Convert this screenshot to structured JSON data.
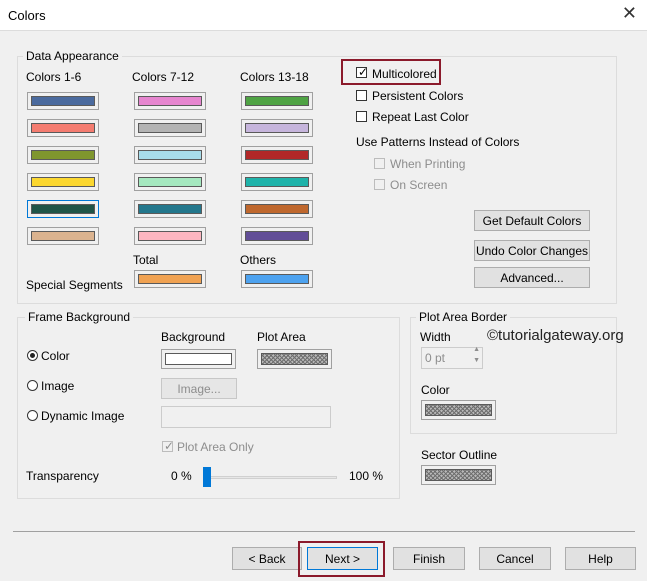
{
  "window": {
    "title": "Colors"
  },
  "data_appearance": {
    "label": "Data Appearance",
    "col1_label": "Colors 1-6",
    "col2_label": "Colors 7-12",
    "col3_label": "Colors 13-18",
    "colors_1_6": [
      "#4a6a9e",
      "#f47c70",
      "#7f962e",
      "#fbd730",
      "#1f5448",
      "#dbb38f"
    ],
    "colors_7_12": [
      "#e685cf",
      "#b3b3b3",
      "#a7dcea",
      "#a5e8bf",
      "#23778c",
      "#fdb6c0"
    ],
    "colors_13_18": [
      "#4fa344",
      "#c6b5dc",
      "#b22828",
      "#1fb3aa",
      "#bf682e",
      "#624e97"
    ],
    "special_label": "Special Segments",
    "total_label": "Total",
    "others_label": "Others",
    "total_color": "#f0a252",
    "others_color": "#4da2ef",
    "multicolored": "Multicolored",
    "persistent": "Persistent Colors",
    "repeat_last": "Repeat Last Color",
    "patterns_label": "Use Patterns Instead of Colors",
    "when_printing": "When Printing",
    "on_screen": "On Screen",
    "get_default": "Get Default Colors",
    "undo_changes": "Undo Color Changes",
    "advanced": "Advanced..."
  },
  "frame_background": {
    "label": "Frame Background",
    "background_label": "Background",
    "plot_area_label": "Plot Area",
    "opt_color": "Color",
    "opt_image": "Image",
    "opt_dynamic": "Dynamic Image",
    "image_button": "Image...",
    "plot_area_only": "Plot Area Only",
    "transparency_label": "Transparency",
    "min_label": "0 %",
    "max_label": "100 %",
    "transparency_value": 0
  },
  "plot_area_border": {
    "label": "Plot Area Border",
    "width_label": "Width",
    "width_value": "0 pt",
    "color_label": "Color",
    "watermark": "©tutorialgateway.org"
  },
  "sector_outline": {
    "label": "Sector Outline"
  },
  "footer": {
    "back": "< Back",
    "next": "Next >",
    "finish": "Finish",
    "cancel": "Cancel",
    "help": "Help"
  }
}
